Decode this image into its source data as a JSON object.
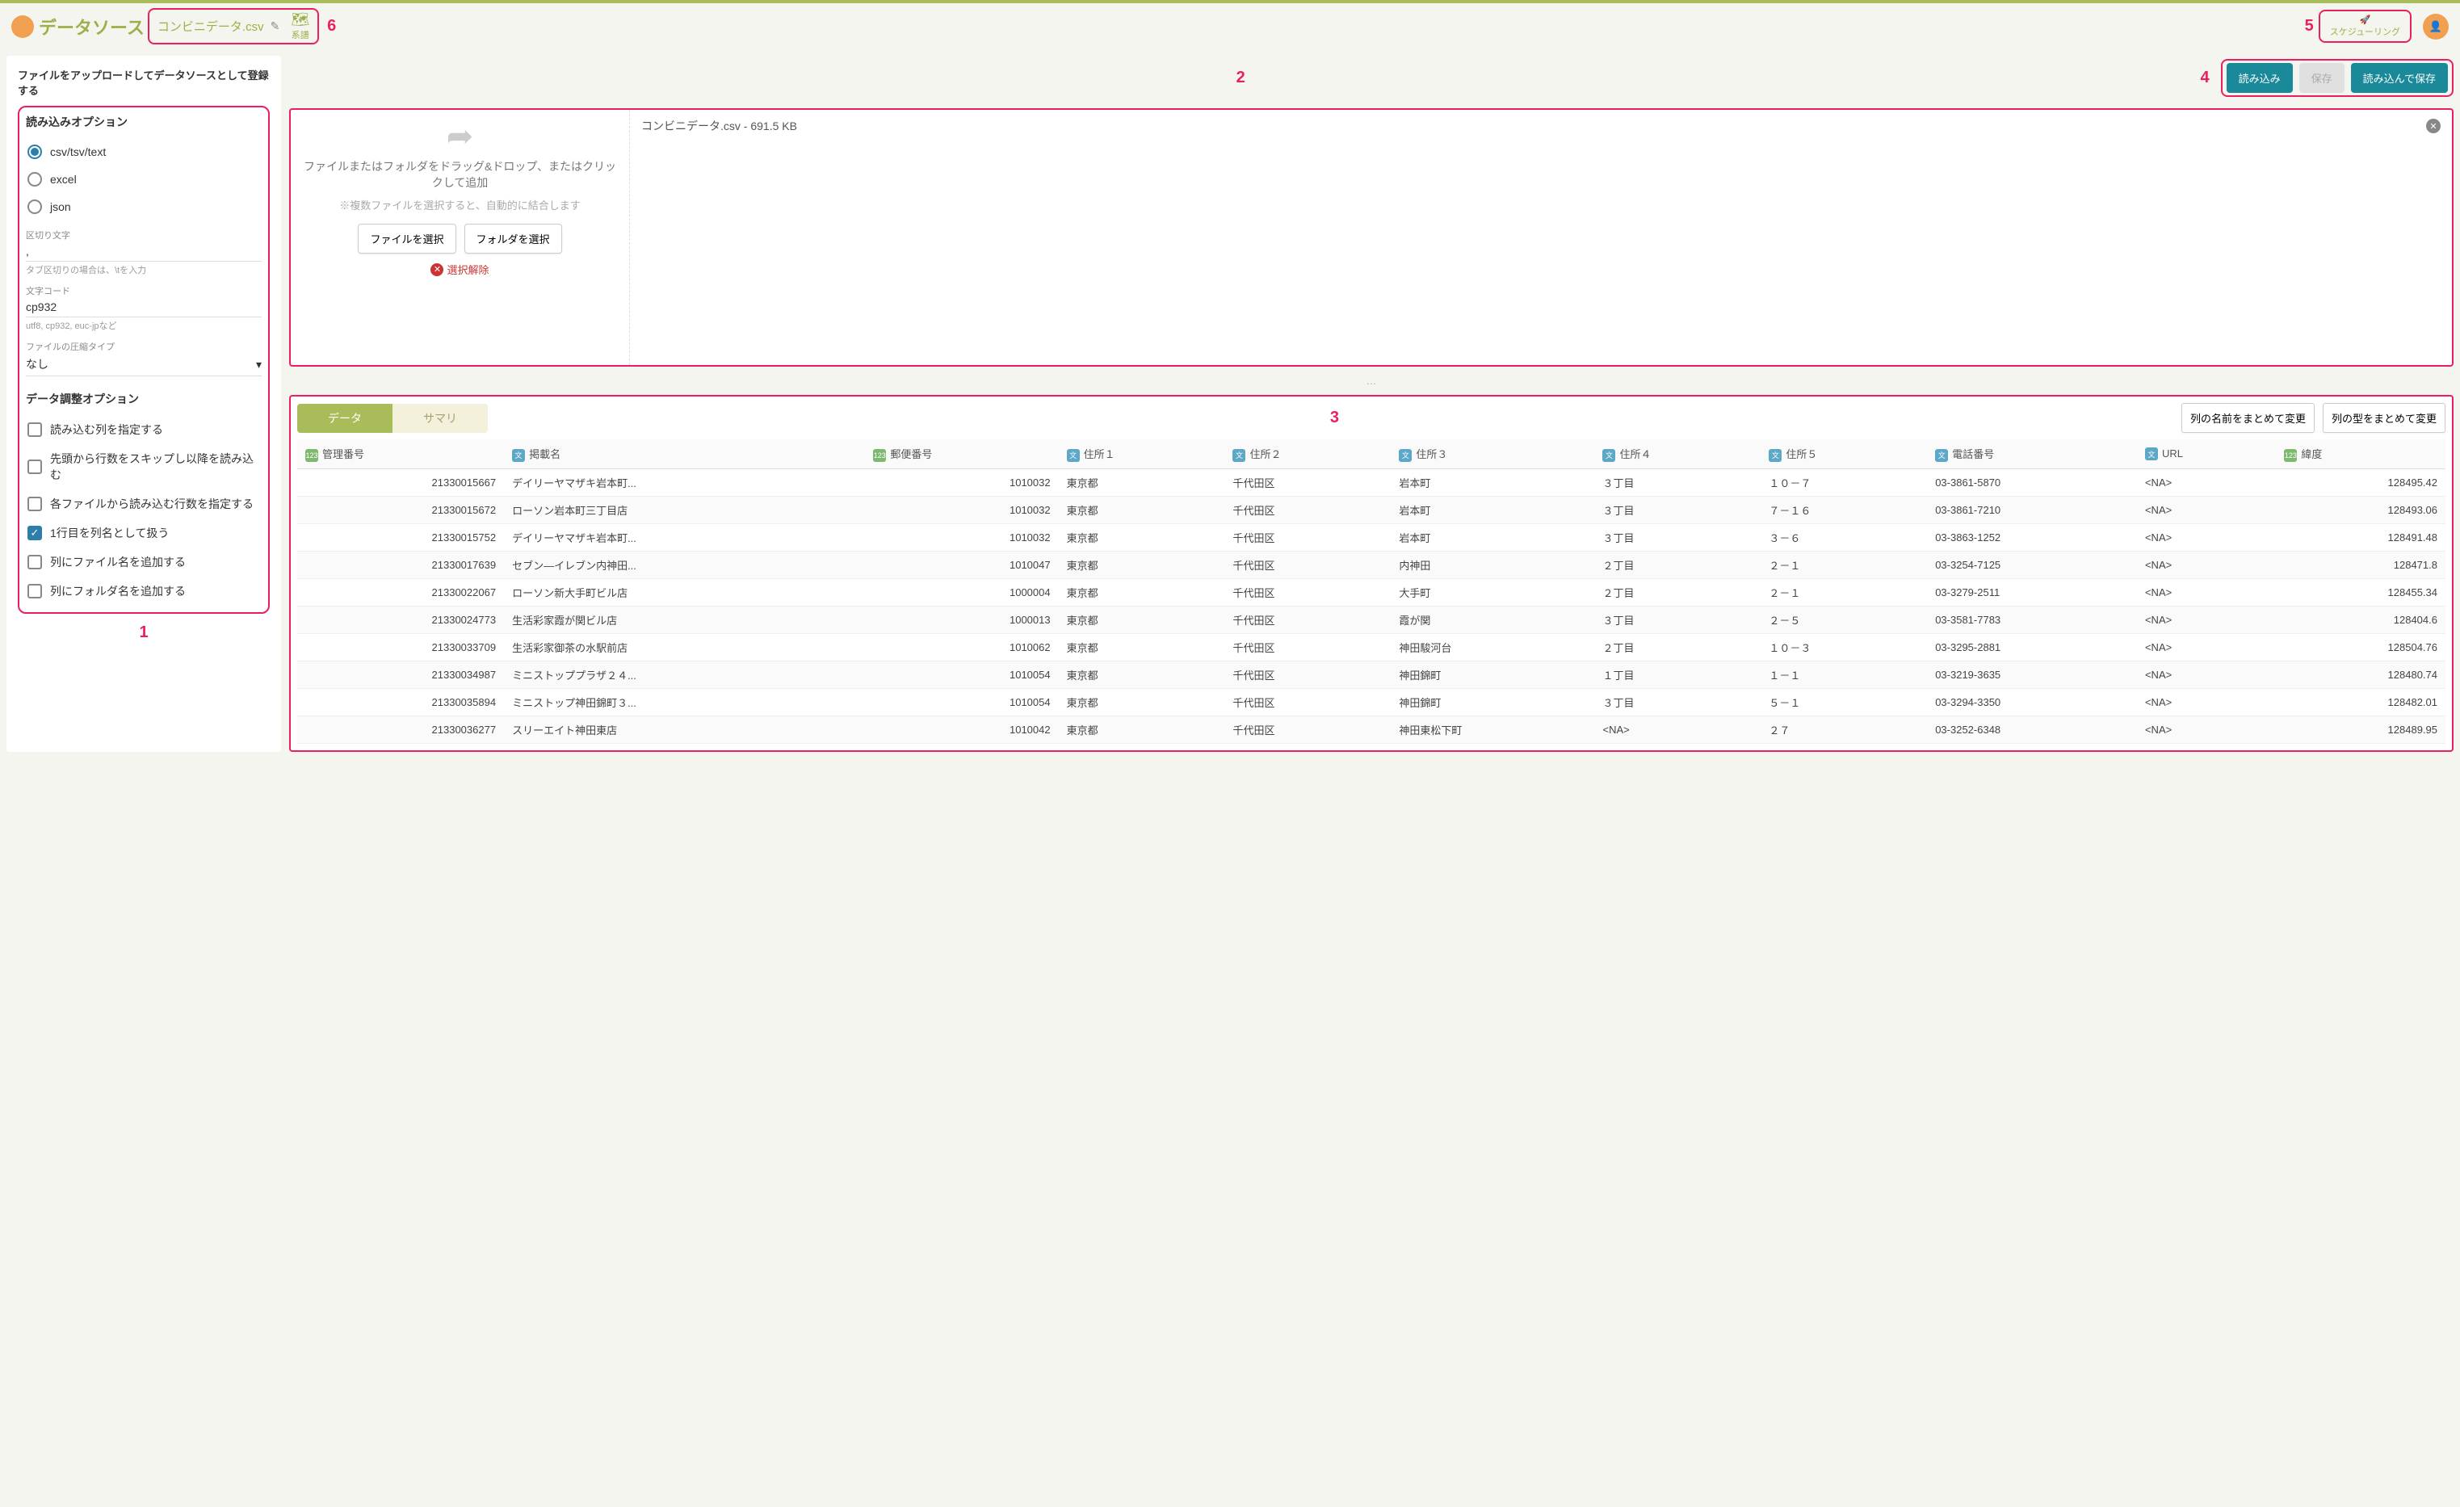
{
  "header": {
    "logo_text": "データソース",
    "filename": "コンビニデータ.csv",
    "lineage_label": "系譜",
    "schedule_label": "スケジューリング"
  },
  "callouts": {
    "c1": "1",
    "c2": "2",
    "c3": "3",
    "c4": "4",
    "c5": "5",
    "c6": "6"
  },
  "sidebar": {
    "upload_title": "ファイルをアップロードしてデータソースとして登録する",
    "load_options_title": "読み込みオプション",
    "radios": {
      "csv": "csv/tsv/text",
      "excel": "excel",
      "json": "json"
    },
    "delim_label": "区切り文字",
    "delim_value": ",",
    "delim_hint": "タブ区切りの場合は、\\tを入力",
    "encoding_label": "文字コード",
    "encoding_value": "cp932",
    "encoding_hint": "utf8, cp932, euc-jpなど",
    "compress_label": "ファイルの圧縮タイプ",
    "compress_value": "なし",
    "adjust_title": "データ調整オプション",
    "checks": {
      "specify_cols": "読み込む列を指定する",
      "skip_rows": "先頭から行数をスキップし以降を読み込む",
      "limit_rows": "各ファイルから読み込む行数を指定する",
      "first_row_header": "1行目を列名として扱う",
      "add_filename": "列にファイル名を追加する",
      "add_foldername": "列にフォルダ名を追加する"
    }
  },
  "actions": {
    "load": "読み込み",
    "save": "保存",
    "load_save": "読み込んで保存"
  },
  "dropzone": {
    "text1": "ファイルまたはフォルダをドラッグ&ドロップ、またはクリックして追加",
    "text2": "※複数ファイルを選択すると、自動的に結合します",
    "btn_file": "ファイルを選択",
    "btn_folder": "フォルダを選択",
    "clear": "選択解除"
  },
  "filelist": {
    "item": "コンビニデータ.csv - 691.5 KB"
  },
  "data_tabs": {
    "data": "データ",
    "summary": "サマリ"
  },
  "col_actions": {
    "rename": "列の名前をまとめて変更",
    "retype": "列の型をまとめて変更"
  },
  "table": {
    "headers": [
      {
        "label": "管理番号",
        "type": "num"
      },
      {
        "label": "掲載名",
        "type": "txt"
      },
      {
        "label": "郵便番号",
        "type": "num"
      },
      {
        "label": "住所１",
        "type": "txt"
      },
      {
        "label": "住所２",
        "type": "txt"
      },
      {
        "label": "住所３",
        "type": "txt"
      },
      {
        "label": "住所４",
        "type": "txt"
      },
      {
        "label": "住所５",
        "type": "txt"
      },
      {
        "label": "電話番号",
        "type": "txt"
      },
      {
        "label": "URL",
        "type": "txt"
      },
      {
        "label": "緯度",
        "type": "num"
      }
    ],
    "rows": [
      [
        "21330015667",
        "デイリーヤマザキ岩本町...",
        "1010032",
        "東京都",
        "千代田区",
        "岩本町",
        "３丁目",
        "１０－７",
        "03-3861-5870",
        "<NA>",
        "128495.42"
      ],
      [
        "21330015672",
        "ローソン岩本町三丁目店",
        "1010032",
        "東京都",
        "千代田区",
        "岩本町",
        "３丁目",
        "７－１６",
        "03-3861-7210",
        "<NA>",
        "128493.06"
      ],
      [
        "21330015752",
        "デイリーヤマザキ岩本町...",
        "1010032",
        "東京都",
        "千代田区",
        "岩本町",
        "３丁目",
        "３－６",
        "03-3863-1252",
        "<NA>",
        "128491.48"
      ],
      [
        "21330017639",
        "セブン―イレブン内神田...",
        "1010047",
        "東京都",
        "千代田区",
        "内神田",
        "２丁目",
        "２－１",
        "03-3254-7125",
        "<NA>",
        "128471.8"
      ],
      [
        "21330022067",
        "ローソン新大手町ビル店",
        "1000004",
        "東京都",
        "千代田区",
        "大手町",
        "２丁目",
        "２－１",
        "03-3279-2511",
        "<NA>",
        "128455.34"
      ],
      [
        "21330024773",
        "生活彩家霞が関ビル店",
        "1000013",
        "東京都",
        "千代田区",
        "霞が関",
        "３丁目",
        "２－５",
        "03-3581-7783",
        "<NA>",
        "128404.6"
      ],
      [
        "21330033709",
        "生活彩家御茶の水駅前店",
        "1010062",
        "東京都",
        "千代田区",
        "神田駿河台",
        "２丁目",
        "１０－３",
        "03-3295-2881",
        "<NA>",
        "128504.76"
      ],
      [
        "21330034987",
        "ミニストッププラザ２４...",
        "1010054",
        "東京都",
        "千代田区",
        "神田錦町",
        "１丁目",
        "１－１",
        "03-3219-3635",
        "<NA>",
        "128480.74"
      ],
      [
        "21330035894",
        "ミニストップ神田錦町３...",
        "1010054",
        "東京都",
        "千代田区",
        "神田錦町",
        "３丁目",
        "５－１",
        "03-3294-3350",
        "<NA>",
        "128482.01"
      ],
      [
        "21330036277",
        "スリーエイト神田東店",
        "1010042",
        "東京都",
        "千代田区",
        "神田東松下町",
        "<NA>",
        "２７",
        "03-3252-6348",
        "<NA>",
        "128489.95"
      ]
    ]
  }
}
